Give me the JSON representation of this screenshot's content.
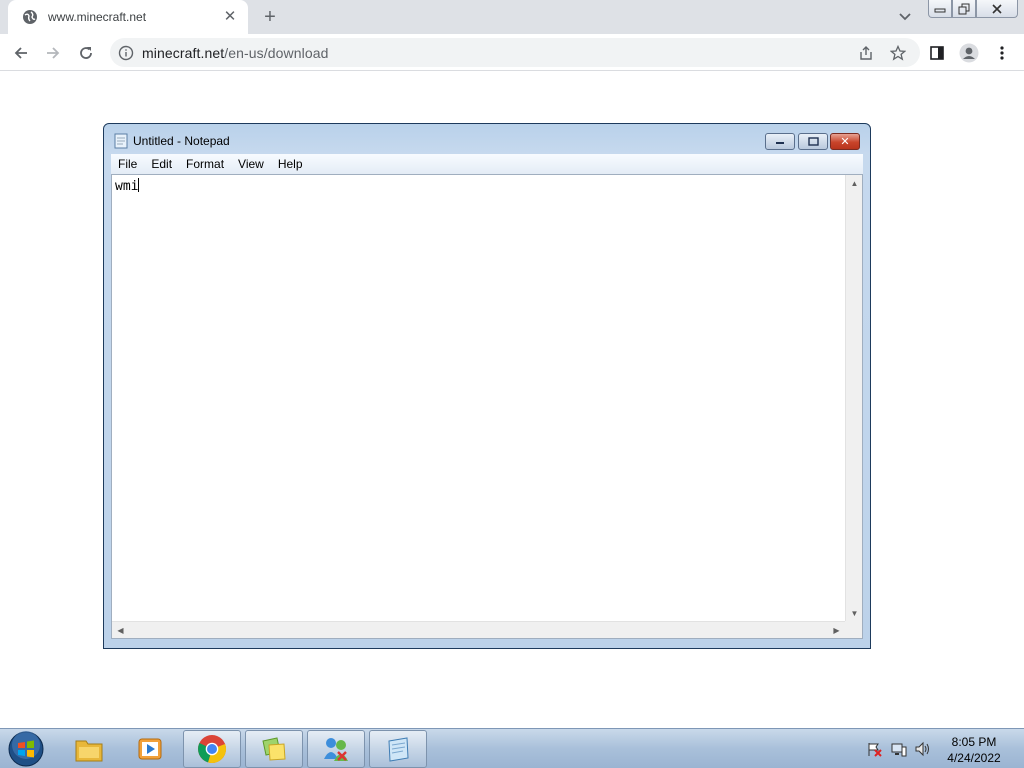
{
  "browser": {
    "tab": {
      "title": "www.minecraft.net",
      "close_glyph": "✕",
      "icon": "globe-icon"
    },
    "new_tab_glyph": "+",
    "address": {
      "domain": "minecraft.net",
      "path": "/en-us/download"
    }
  },
  "notepad": {
    "title": "Untitled - Notepad",
    "menu": [
      "File",
      "Edit",
      "Format",
      "View",
      "Help"
    ],
    "content": "wmi",
    "close_glyph": "✕"
  },
  "taskbar": {
    "apps": [
      "windows-explorer-icon",
      "media-player-icon",
      "chrome-icon",
      "sticky-notes-icon",
      "remote-assistance-icon",
      "notepad-icon"
    ],
    "clock": {
      "time": "8:05 PM",
      "date": "4/24/2022"
    }
  },
  "colors": {
    "accent": "#1a73e8",
    "close_red": "#c8442b",
    "taskbar": "#a9c0da"
  }
}
